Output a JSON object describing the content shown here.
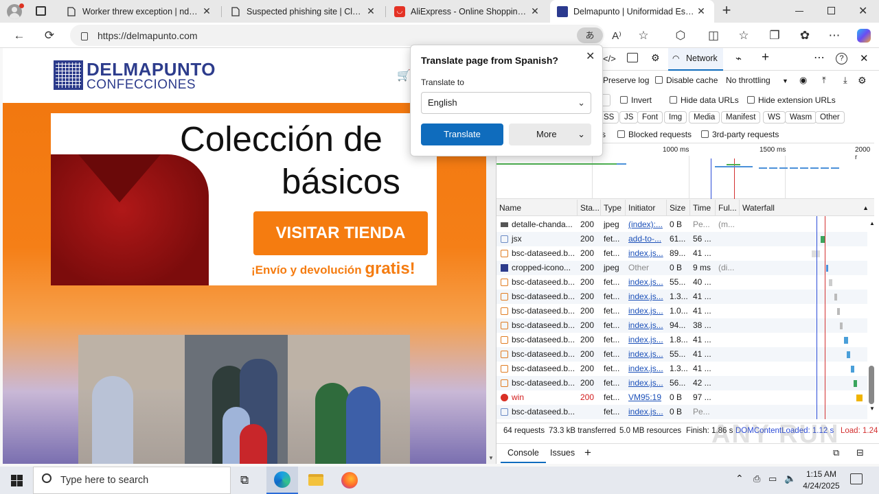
{
  "browser": {
    "tabs": [
      {
        "title": "Worker threw exception | ndgadf",
        "icon": "page-icon"
      },
      {
        "title": "Suspected phishing site | Cloudfl",
        "icon": "page-icon"
      },
      {
        "title": "AliExpress - Online Shopping für",
        "icon": "aliexpress-icon"
      },
      {
        "title": "Delmapunto | Uniformidad Escol",
        "icon": "delmapunto-icon",
        "active": true
      }
    ],
    "url": "https://delmapunto.com",
    "translate_badge": "あ"
  },
  "site": {
    "logo_line1": "DELMAPUNTO",
    "logo_line2": "CONFECCIONES",
    "banner_title_1": "Colección de",
    "banner_title_2": "básicos",
    "banner_button": "VISITAR TIENDA",
    "banner_footer_a": "¡Envío y devolución ",
    "banner_footer_b": "gratis!"
  },
  "translate_popup": {
    "title": "Translate page from Spanish?",
    "label": "Translate to",
    "language": "English",
    "translate_btn": "Translate",
    "more_btn": "More"
  },
  "devtools": {
    "network_tab": "Network",
    "preserve_log": "Preserve log",
    "disable_cache": "Disable cache",
    "throttling": "No throttling",
    "invert": "Invert",
    "hide_data_urls": "Hide data URLs",
    "hide_ext_urls": "Hide extension URLs",
    "filters": [
      "SS",
      "JS",
      "Font",
      "Img",
      "Media",
      "Manifest",
      "WS",
      "Wasm",
      "Other"
    ],
    "filter_s": "s",
    "blocked_requests": "Blocked requests",
    "third_party": "3rd-party requests",
    "timeline_ticks": [
      "1000 ms",
      "1500 ms",
      "2000 r"
    ],
    "columns": [
      "Name",
      "Sta...",
      "Type",
      "Initiator",
      "Size",
      "Time",
      "Ful...",
      "Waterfall"
    ],
    "rows": [
      {
        "name": "detalle-chanda...",
        "status": "200",
        "type": "jpeg",
        "init": "(index):...",
        "size": "0 B",
        "time": "Pe...",
        "full": "(m...",
        "icon": "img"
      },
      {
        "name": "jsx",
        "status": "200",
        "type": "fet...",
        "init": "add-to-...",
        "size": "61...",
        "time": "56 ...",
        "full": "",
        "icon": "doc"
      },
      {
        "name": "bsc-dataseed.b...",
        "status": "200",
        "type": "fet...",
        "init": "index.js...",
        "size": "89...",
        "time": "41 ...",
        "full": "",
        "icon": "fetch"
      },
      {
        "name": "cropped-icono...",
        "status": "200",
        "type": "jpeg",
        "init": "Other",
        "size": "0 B",
        "time": "9 ms",
        "full": "(di...",
        "icon": "imgblue"
      },
      {
        "name": "bsc-dataseed.b...",
        "status": "200",
        "type": "fet...",
        "init": "index.js...",
        "size": "55...",
        "time": "40 ...",
        "full": "",
        "icon": "fetch"
      },
      {
        "name": "bsc-dataseed.b...",
        "status": "200",
        "type": "fet...",
        "init": "index.js...",
        "size": "1.3...",
        "time": "41 ...",
        "full": "",
        "icon": "fetch"
      },
      {
        "name": "bsc-dataseed.b...",
        "status": "200",
        "type": "fet...",
        "init": "index.js...",
        "size": "1.0...",
        "time": "41 ...",
        "full": "",
        "icon": "fetch"
      },
      {
        "name": "bsc-dataseed.b...",
        "status": "200",
        "type": "fet...",
        "init": "index.js...",
        "size": "94...",
        "time": "38 ...",
        "full": "",
        "icon": "fetch"
      },
      {
        "name": "bsc-dataseed.b...",
        "status": "200",
        "type": "fet...",
        "init": "index.js...",
        "size": "1.8...",
        "time": "41 ...",
        "full": "",
        "icon": "fetch"
      },
      {
        "name": "bsc-dataseed.b...",
        "status": "200",
        "type": "fet...",
        "init": "index.js...",
        "size": "55...",
        "time": "41 ...",
        "full": "",
        "icon": "fetch"
      },
      {
        "name": "bsc-dataseed.b...",
        "status": "200",
        "type": "fet...",
        "init": "index.js...",
        "size": "1.3...",
        "time": "41 ...",
        "full": "",
        "icon": "fetch"
      },
      {
        "name": "bsc-dataseed.b...",
        "status": "200",
        "type": "fet...",
        "init": "index.js...",
        "size": "56...",
        "time": "42 ...",
        "full": "",
        "icon": "fetch"
      },
      {
        "name": "win",
        "status": "200",
        "type": "fet...",
        "init": "VM95:19",
        "size": "0 B",
        "time": "97 ...",
        "full": "",
        "icon": "error",
        "error": true
      },
      {
        "name": "bsc-dataseed.b...",
        "status": "",
        "type": "fet...",
        "init": "index.js...",
        "size": "0 B",
        "time": "Pe...",
        "full": "",
        "icon": "doc"
      }
    ],
    "status_bar": {
      "requests": "64 requests",
      "transferred": "73.3 kB transferred",
      "resources": "5.0 MB resources",
      "finish": "Finish: 1.86 s",
      "dcl": "DOMContentLoaded: 1.12 s",
      "load": "Load: 1.24"
    },
    "drawer_tabs": [
      "Console",
      "Issues"
    ]
  },
  "taskbar": {
    "search_placeholder": "Type here to search",
    "time": "1:15 AM",
    "date": "4/24/2025"
  },
  "watermark": "ANY RUN"
}
